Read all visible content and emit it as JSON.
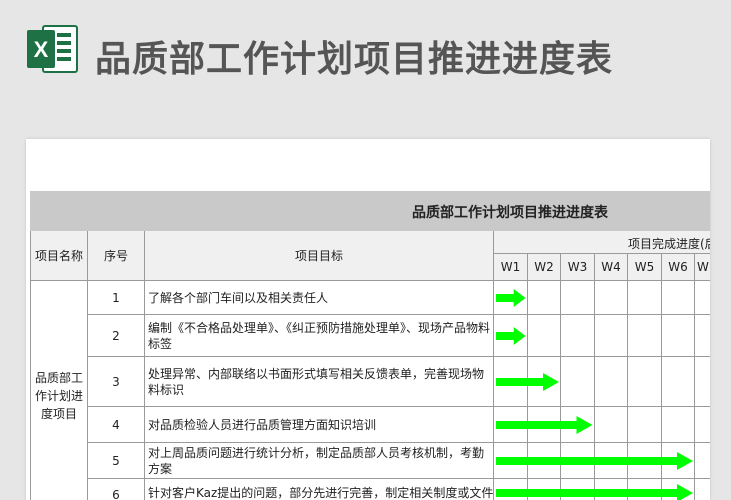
{
  "header": {
    "title": "品质部工作计划项目推进进度表",
    "logo_letter": "X"
  },
  "sheet": {
    "banner_title": "品质部工作计划项目推进进度表",
    "columns": {
      "project_name": "项目名称",
      "seq": "序号",
      "goal": "项目目标",
      "progress_group": "项目完成进度(后"
    },
    "weeks": [
      "W1",
      "W2",
      "W3",
      "W4",
      "W5",
      "W6",
      "W"
    ],
    "project_name_value": "品质部工作计划进度项目",
    "rows": [
      {
        "seq": "1",
        "goal": "了解各个部门车间以及相关责任人",
        "progress_weeks": 1
      },
      {
        "seq": "2",
        "goal": "编制《不合格品处理单》、《纠正预防措施处理单》、现场产品物料标签",
        "progress_weeks": 1
      },
      {
        "seq": "3",
        "goal": "处理异常、内部联络以书面形式填写相关反馈表单，完善现场物料标识",
        "progress_weeks": 2
      },
      {
        "seq": "4",
        "goal": "对品质检验人员进行品质管理方面知识培训",
        "progress_weeks": 3
      },
      {
        "seq": "5",
        "goal": "对上周品质问题进行统计分析，制定品质部人员考核机制，考勤方案",
        "progress_weeks": 6
      },
      {
        "seq": "6",
        "goal": "针对客户Kaz提出的问题，部分先进行完善，制定相关制度或文件及",
        "progress_weeks": 6
      }
    ]
  },
  "colors": {
    "arrow": "#00ff00",
    "banner": "#c9c9c9",
    "excel_green": "#1e7145"
  }
}
